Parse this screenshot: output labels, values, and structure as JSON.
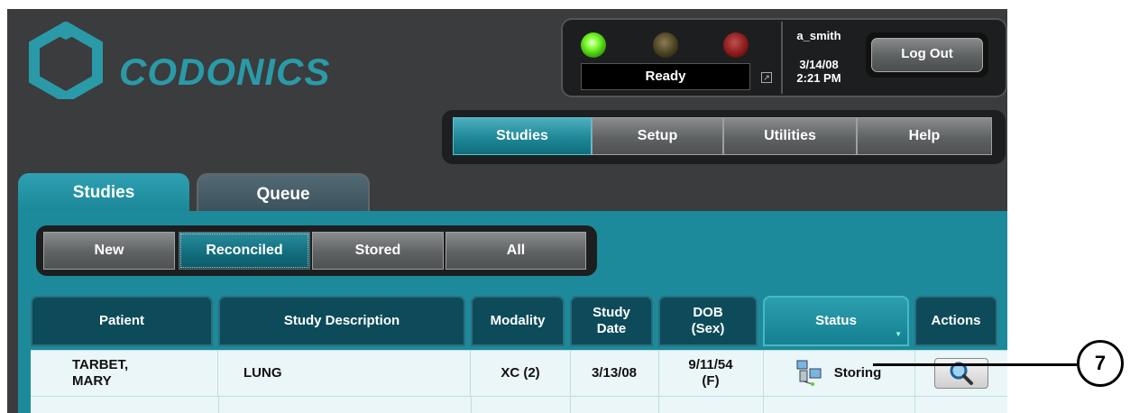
{
  "brand": {
    "name": "CODONICS",
    "color": "#2a9aa8"
  },
  "status_panel": {
    "lights": [
      "green",
      "yellow",
      "red"
    ],
    "status_text": "Ready",
    "user": "a_smith",
    "date": "3/14/08",
    "time": "2:21 PM",
    "logout_label": "Log Out"
  },
  "main_nav": {
    "items": [
      {
        "label": "Studies",
        "active": true
      },
      {
        "label": "Setup",
        "active": false
      },
      {
        "label": "Utilities",
        "active": false
      },
      {
        "label": "Help",
        "active": false
      }
    ]
  },
  "tabs": [
    {
      "label": "Studies",
      "active": true
    },
    {
      "label": "Queue",
      "active": false
    }
  ],
  "sub_nav": {
    "items": [
      {
        "label": "New",
        "active": false
      },
      {
        "label": "Reconciled",
        "active": true
      },
      {
        "label": "Stored",
        "active": false
      },
      {
        "label": "All",
        "active": false
      }
    ]
  },
  "table": {
    "columns": [
      "Patient",
      "Study Description",
      "Modality",
      "Study\nDate",
      "DOB\n(Sex)",
      "Status",
      "Actions"
    ],
    "rows": [
      {
        "patient": "TARBET,\nMARY",
        "description": "LUNG",
        "modality": "XC (2)",
        "study_date": "3/13/08",
        "dob_sex": "9/11/54\n(F)",
        "status": "Storing",
        "action_icon": "magnifier-icon"
      }
    ]
  },
  "callout": {
    "number": "7"
  },
  "colors": {
    "accent": "#1c8a9b",
    "background": "#3a3c3d",
    "header": "#0d4b5a"
  }
}
